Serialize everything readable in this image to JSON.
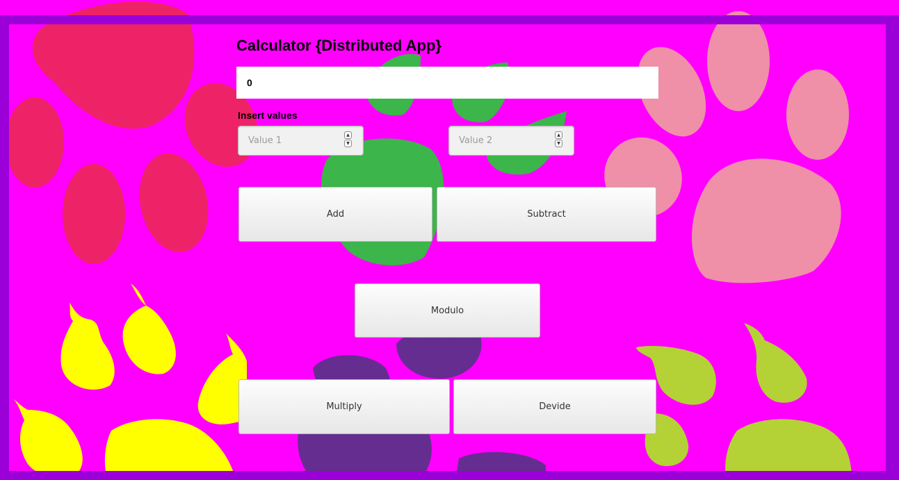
{
  "app": {
    "title": "Calculator {Distributed App}",
    "result_value": "0",
    "insert_label": "Insert values"
  },
  "inputs": {
    "value1_placeholder": "Value 1",
    "value2_placeholder": "Value 2"
  },
  "buttons": {
    "add": "Add",
    "subtract": "Subtract",
    "modulo": "Modulo",
    "multiply": "Multiply",
    "divide": "Devide"
  },
  "colors": {
    "background": "#ff00ff",
    "frame": "#9b00d8",
    "paw_red": "#ee2266",
    "paw_green": "#3cb54a",
    "paw_pink": "#ef8fa8",
    "paw_purple": "#662d91",
    "pear_yellow": "#ffff00",
    "pear_lime": "#b4d235"
  }
}
